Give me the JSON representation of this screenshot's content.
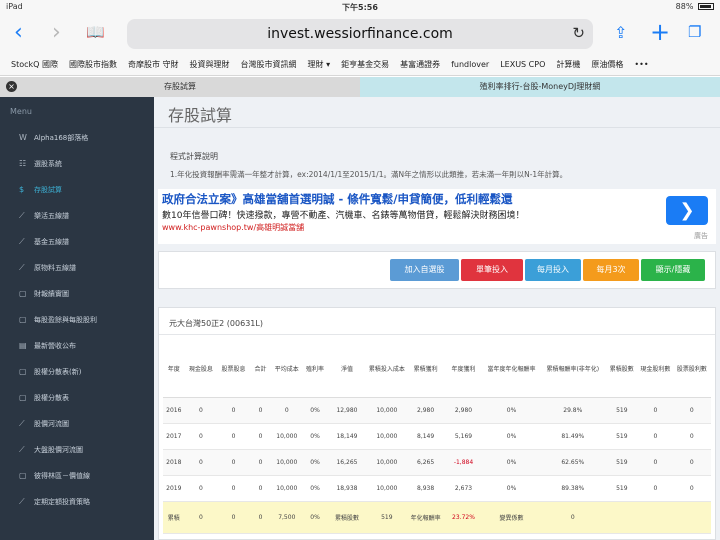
{
  "status_bar": {
    "device": "iPad",
    "time": "下午5:56",
    "battery": "88%",
    "battery_level": 0.88
  },
  "browser": {
    "url": "invest.wessiorfinance.com"
  },
  "bookmarks": [
    "StockQ 國際",
    "國際股市指數",
    "奇摩股市 守財",
    "投資與理財",
    "台灣股市資訊網",
    "理財 ▾",
    "鉅亨基金交易",
    "基富通證券",
    "fundlover",
    "LEXUS CPO",
    "計算機",
    "原油價格",
    "•••"
  ],
  "tabs": [
    {
      "label": "存股試算"
    },
    {
      "label": "殖利率排行-台股-MoneyDJ理財網"
    }
  ],
  "sidebar": {
    "title": "Menu",
    "items": [
      {
        "label": "Alpha168部落格",
        "icon": "wordpress-icon",
        "glyph": "W"
      },
      {
        "label": "選股系統",
        "icon": "list-icon",
        "glyph": "☷"
      },
      {
        "label": "存股試算",
        "icon": "dollar-icon",
        "glyph": "$"
      },
      {
        "label": "樂活五線譜",
        "icon": "line-chart-icon",
        "glyph": "⟋"
      },
      {
        "label": "基金五線譜",
        "icon": "line-chart-icon",
        "glyph": "⟋"
      },
      {
        "label": "原物料五線譜",
        "icon": "line-chart-icon",
        "glyph": "⟋"
      },
      {
        "label": "財報績實圖",
        "icon": "square-icon",
        "glyph": "▢"
      },
      {
        "label": "每股盈餘與每股股利",
        "icon": "square-icon",
        "glyph": "▢"
      },
      {
        "label": "最新營收公布",
        "icon": "table-icon",
        "glyph": "▤"
      },
      {
        "label": "股權分散表(新)",
        "icon": "square-icon",
        "glyph": "▢"
      },
      {
        "label": "股權分散表",
        "icon": "square-icon",
        "glyph": "▢"
      },
      {
        "label": "股價河流圖",
        "icon": "line-chart-icon",
        "glyph": "⟋"
      },
      {
        "label": "大盤股價河流圖",
        "icon": "line-chart-icon",
        "glyph": "⟋"
      },
      {
        "label": "彼得林區－價值線",
        "icon": "square-icon",
        "glyph": "▢"
      },
      {
        "label": "定期定額投資策略",
        "icon": "line-chart-icon",
        "glyph": "⟋"
      }
    ]
  },
  "page": {
    "title": "存股試算",
    "description_title": "程式計算說明",
    "description": "1.年化投資報酬率需滿一年整才計算，ex:2014/1/1至2015/1/1。滿N年之情形以此類推，若未滿一年則以N-1年計算。"
  },
  "ad": {
    "headline": "政府合法立案》高雄當舖首選明誠 - 條件寬鬆/申貸簡便，低利輕鬆還",
    "body": "數10年信譽口碑！快速撥款，專營不動產、汽機車、名錶等萬物借貸，輕鬆解決財務困境！",
    "link": "www.khc-pawnshop.tw/高雄明誠當舖",
    "label": "廣告",
    "button_glyph": "❯"
  },
  "buttons": [
    {
      "label": "加入自選股",
      "color": "#5b9bd5"
    },
    {
      "label": "單筆投入",
      "color": "#e0343e"
    },
    {
      "label": "每月投入",
      "color": "#3b9fd8"
    },
    {
      "label": "每月3次",
      "color": "#f49b1c"
    },
    {
      "label": "顯示/隱藏",
      "color": "#2bb34a"
    }
  ],
  "table": {
    "title": "元大台灣50正2 (00631L)",
    "headers": [
      "年度",
      "現金股息",
      "股票股息",
      "合計",
      "平均成本",
      "殖利率",
      "淨值",
      "累積投入成本",
      "累積獲利",
      "年度獲利",
      "當年度年化報酬率",
      "累積報酬率(非年化)",
      "累積股數",
      "現金股利數",
      "股票股利數"
    ],
    "rows": [
      [
        "2016",
        "0",
        "0",
        "0",
        "0",
        "0%",
        "12,980",
        "10,000",
        "2,980",
        "2,980",
        "0%",
        "29.8%",
        "519",
        "0",
        "0"
      ],
      [
        "2017",
        "0",
        "0",
        "0",
        "10,000",
        "0%",
        "18,149",
        "10,000",
        "8,149",
        "5,169",
        "0%",
        "81.49%",
        "519",
        "0",
        "0"
      ],
      [
        "2018",
        "0",
        "0",
        "0",
        "10,000",
        "0%",
        "16,265",
        "10,000",
        "6,265",
        "-1,884",
        "0%",
        "62.65%",
        "519",
        "0",
        "0"
      ],
      [
        "2019",
        "0",
        "0",
        "0",
        "10,000",
        "0%",
        "18,938",
        "10,000",
        "8,938",
        "2,673",
        "0%",
        "89.38%",
        "519",
        "0",
        "0"
      ]
    ],
    "total_row": [
      "累積",
      "0",
      "0",
      "0",
      "7,500",
      "0%",
      "累積股數",
      "519",
      "年化報酬率",
      "23.72%",
      "變異係數",
      "0",
      "",
      "",
      ""
    ]
  }
}
